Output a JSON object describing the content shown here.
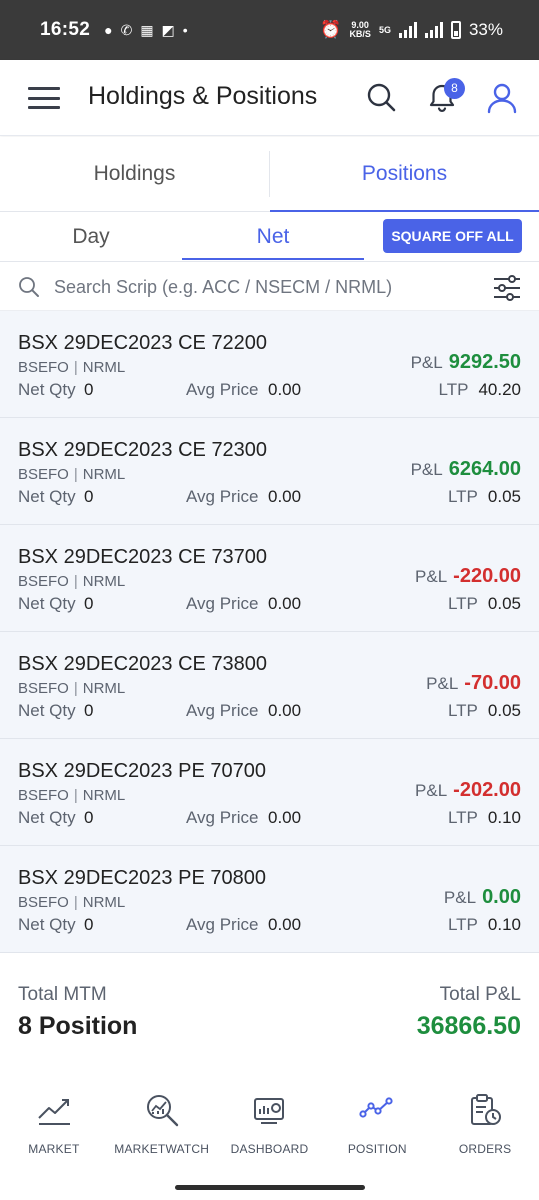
{
  "status_bar": {
    "time": "16:52",
    "net_speed_value": "9.00",
    "net_speed_unit": "KB/S",
    "network_type": "5G",
    "battery": "33%"
  },
  "header": {
    "title": "Holdings & Positions",
    "notification_count": "8"
  },
  "tabs": {
    "holdings": "Holdings",
    "positions": "Positions",
    "active": "Positions"
  },
  "subtabs": {
    "day": "Day",
    "net": "Net",
    "active": "Net",
    "square_off_label": "SQUARE OFF ALL"
  },
  "search": {
    "placeholder": "Search Scrip (e.g. ACC / NSECM / NRML)"
  },
  "labels": {
    "net_qty": "Net Qty",
    "avg_price": "Avg Price",
    "pnl": "P&L",
    "ltp": "LTP"
  },
  "positions": [
    {
      "name": "BSX 29DEC2023 CE 72200",
      "exchange": "BSEFO",
      "product": "NRML",
      "net_qty": "0",
      "avg_price": "0.00",
      "pnl": "9292.50",
      "ltp": "40.20"
    },
    {
      "name": "BSX 29DEC2023 CE 72300",
      "exchange": "BSEFO",
      "product": "NRML",
      "net_qty": "0",
      "avg_price": "0.00",
      "pnl": "6264.00",
      "ltp": "0.05"
    },
    {
      "name": "BSX 29DEC2023 CE 73700",
      "exchange": "BSEFO",
      "product": "NRML",
      "net_qty": "0",
      "avg_price": "0.00",
      "pnl": "-220.00",
      "ltp": "0.05"
    },
    {
      "name": "BSX 29DEC2023 CE 73800",
      "exchange": "BSEFO",
      "product": "NRML",
      "net_qty": "0",
      "avg_price": "0.00",
      "pnl": "-70.00",
      "ltp": "0.05"
    },
    {
      "name": "BSX 29DEC2023 PE 70700",
      "exchange": "BSEFO",
      "product": "NRML",
      "net_qty": "0",
      "avg_price": "0.00",
      "pnl": "-202.00",
      "ltp": "0.10"
    },
    {
      "name": "BSX 29DEC2023 PE 70800",
      "exchange": "BSEFO",
      "product": "NRML",
      "net_qty": "0",
      "avg_price": "0.00",
      "pnl": "0.00",
      "ltp": "0.10"
    }
  ],
  "summary": {
    "total_mtm_label": "Total MTM",
    "position_count": "8 Position",
    "total_pnl_label": "Total P&L",
    "total_pnl": "36866.50"
  },
  "bottom_nav": [
    {
      "label": "MARKET",
      "icon": "trend-chart-icon"
    },
    {
      "label": "MARKETWATCH",
      "icon": "magnify-chart-icon"
    },
    {
      "label": "DASHBOARD",
      "icon": "dashboard-icon"
    },
    {
      "label": "POSITION",
      "icon": "position-line-icon"
    },
    {
      "label": "ORDERS",
      "icon": "orders-clipboard-icon"
    }
  ],
  "colors": {
    "accent": "#4a63e7",
    "profit": "#1e8e3e",
    "loss": "#d32f2f",
    "list_bg": "#f3f6fb"
  }
}
